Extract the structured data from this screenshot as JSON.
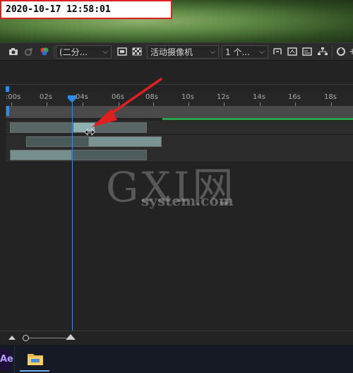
{
  "overlay": {
    "timestamp": "2020-10-17 12:58:01"
  },
  "toolbar": {
    "resolution_value": "(二分...",
    "camera_value": "活动摄像机",
    "views_value": "1 个..."
  },
  "timeline": {
    "ruler_labels": [
      ":00s",
      "02s",
      "04s",
      "06s",
      "08s",
      "10s",
      "12s",
      "14s",
      "16s",
      "18s"
    ],
    "playhead_time_label": "04s"
  },
  "watermark": {
    "big": "GXI网",
    "small": "system.com"
  },
  "colors": {
    "accent_blue": "#2d8ceb",
    "green_line": "#2ea44a",
    "annotation_red": "#e02020"
  },
  "taskbar": {
    "ae_label": "Ae"
  }
}
